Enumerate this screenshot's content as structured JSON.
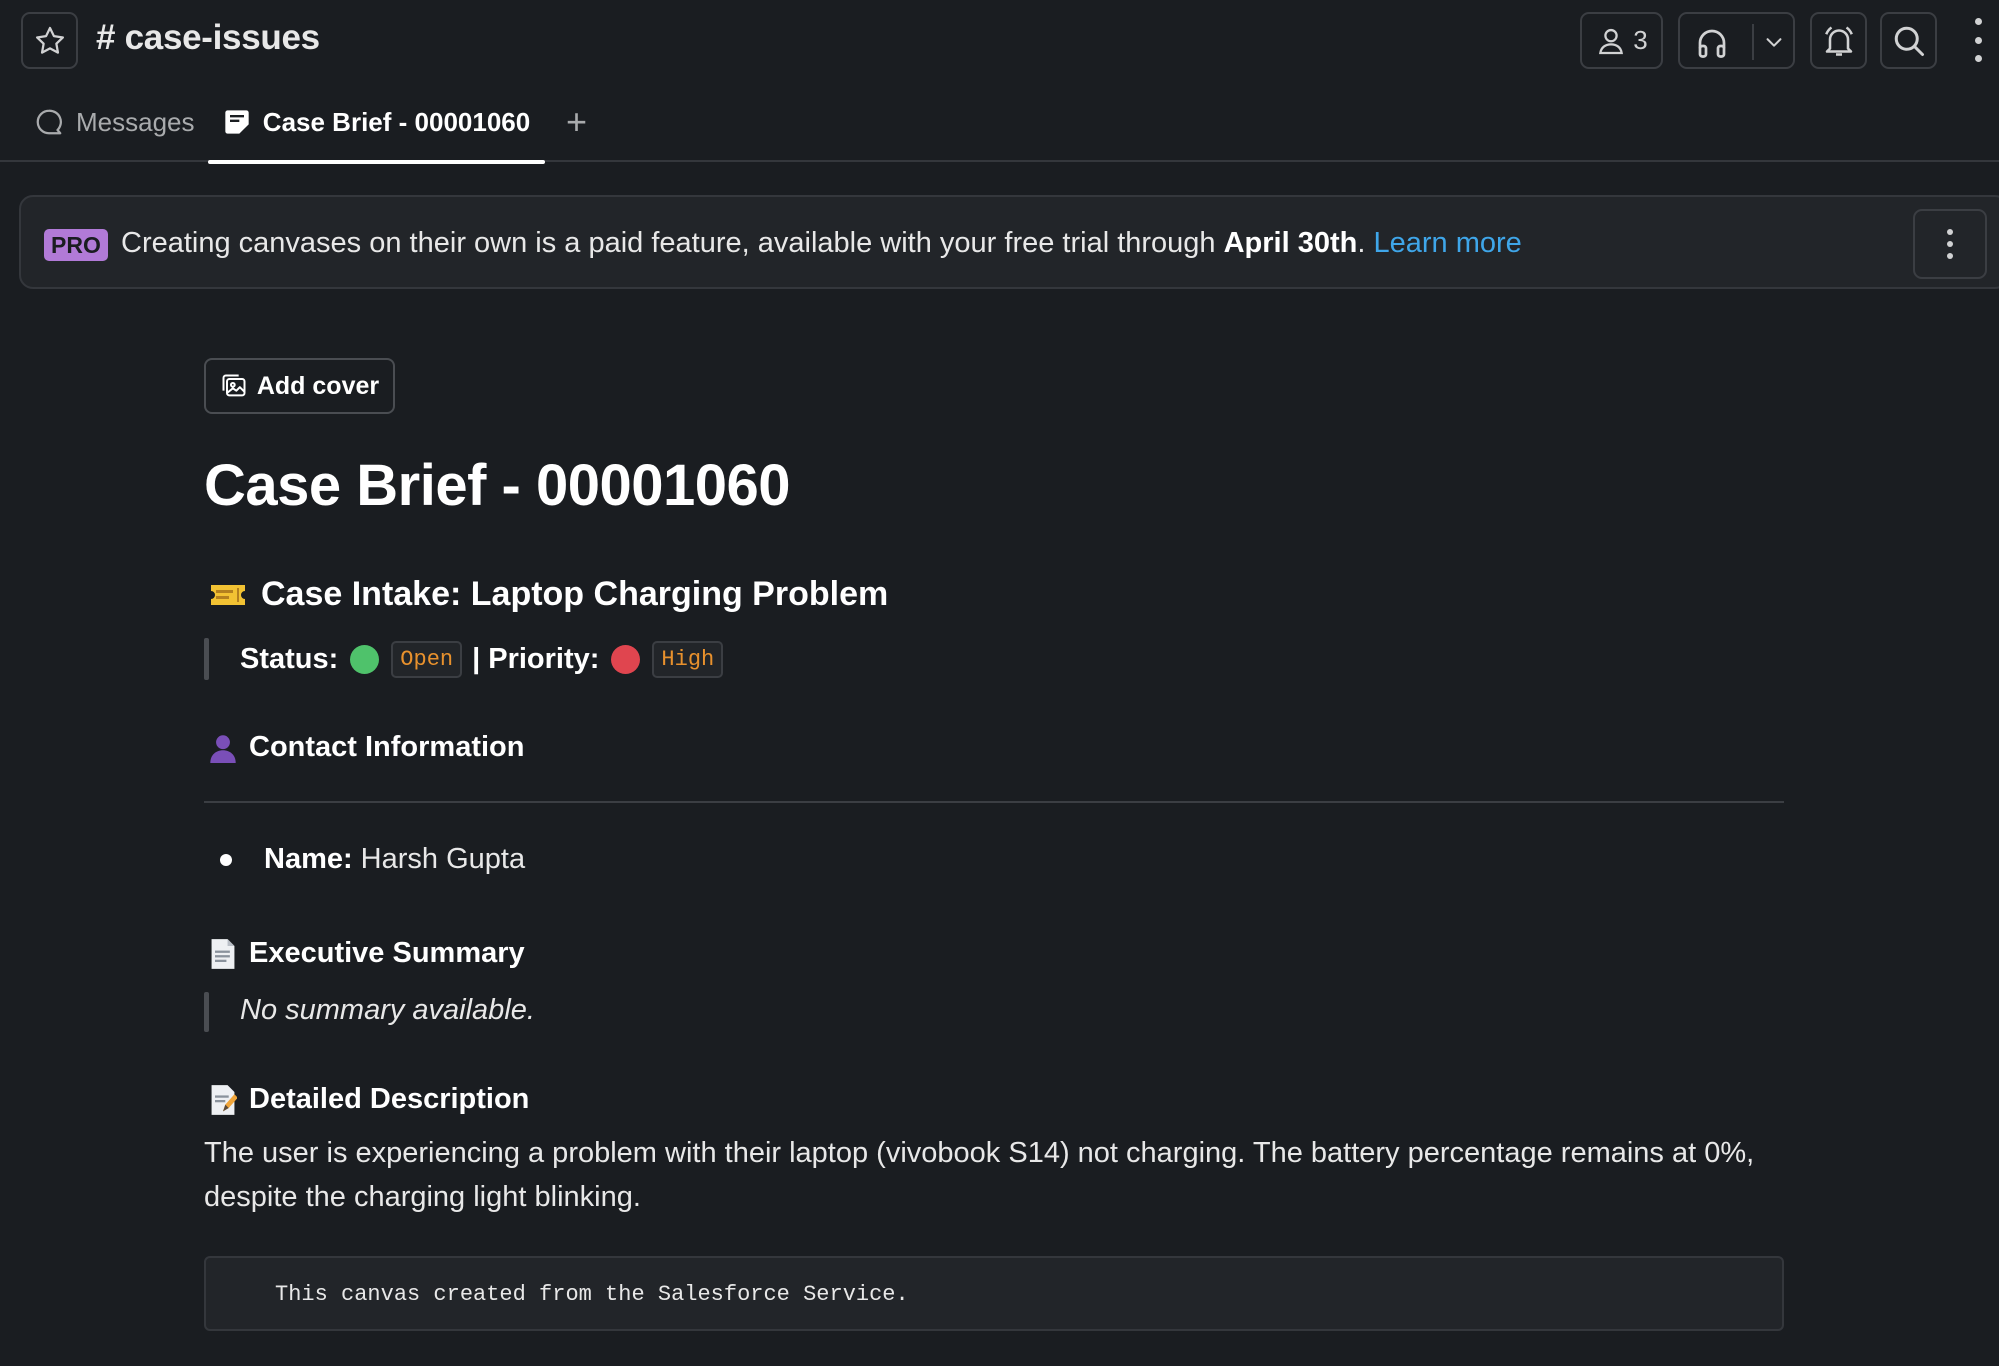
{
  "header": {
    "channel_hash": "#",
    "channel_name": "case-issues",
    "member_count": "3"
  },
  "tabs": [
    {
      "label": "Messages",
      "icon": "message-bubble-icon"
    },
    {
      "label": "Case Brief - 00001060",
      "icon": "canvas-icon"
    }
  ],
  "tab_add_label": "+",
  "banner": {
    "badge": "PRO",
    "text": "Creating canvases on their own is a paid feature, available with your free trial through ",
    "date": "April 30th",
    "period": ".",
    "link": "Learn more"
  },
  "canvas": {
    "add_cover_label": "Add cover",
    "title": "Case Brief - 00001060",
    "intake_heading": "Case Intake: Laptop Charging Problem",
    "status_label": "Status:",
    "status_value": "Open",
    "pipe": "|",
    "priority_label": "Priority:",
    "priority_value": "High",
    "contact_heading": "Contact Information",
    "name_label": "Name:",
    "name_value": "Harsh Gupta",
    "summary_heading": "Executive Summary",
    "summary_text": "No summary available.",
    "description_heading": "Detailed Description",
    "description_text": "The user is experiencing a problem with their laptop (vivobook S14) not charging. The battery percentage remains at 0%, despite the charging light blinking.",
    "code_text": "This canvas created from the Salesforce Service."
  },
  "colors": {
    "background": "#1a1d21",
    "link": "#3fa6e9",
    "pro_badge": "#b17ad7",
    "status_open": "#4fc26b",
    "priority_high": "#e0454f",
    "code_chip_text": "#e8912d"
  }
}
